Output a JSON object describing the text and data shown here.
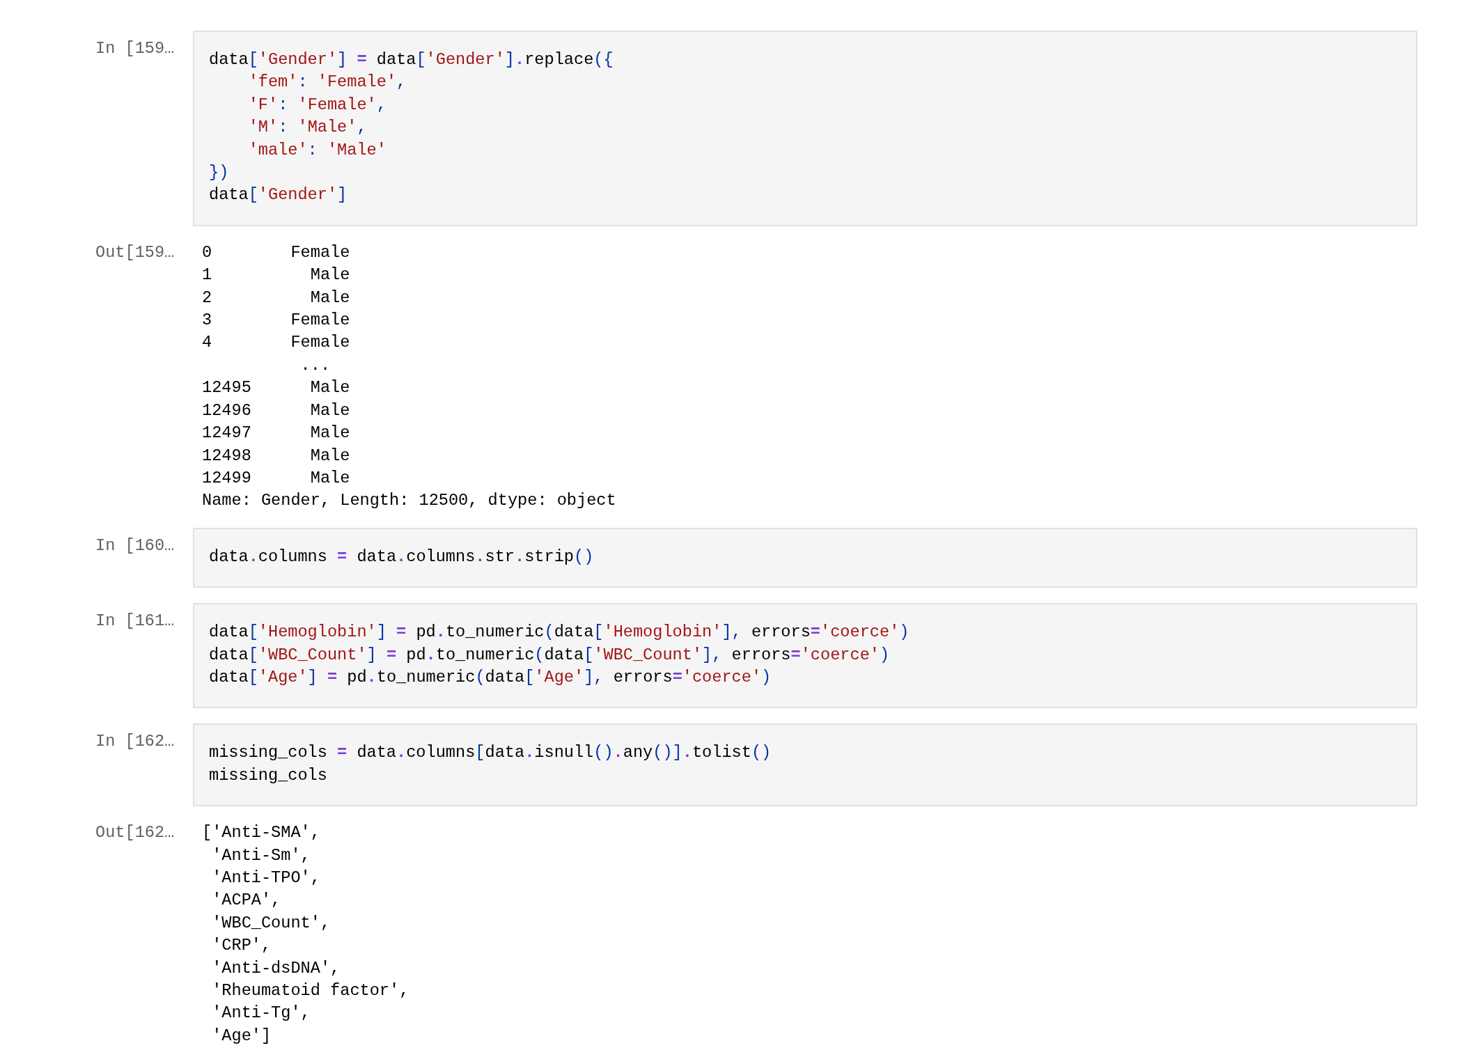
{
  "cells": [
    {
      "kind": "input",
      "prompt": "In [159…",
      "lines": [
        "data['Gender'] = data['Gender'].replace({",
        "    'fem': 'Female',",
        "    'F': 'Female',",
        "    'M': 'Male',",
        "    'male': 'Male'",
        "})",
        "data['Gender']"
      ]
    },
    {
      "kind": "output",
      "prompt": "Out[159…",
      "lines": [
        "0        Female",
        "1          Male",
        "2          Male",
        "3        Female",
        "4        Female",
        "          ...",
        "12495      Male",
        "12496      Male",
        "12497      Male",
        "12498      Male",
        "12499      Male",
        "Name: Gender, Length: 12500, dtype: object"
      ]
    },
    {
      "kind": "input",
      "prompt": "In [160…",
      "lines": [
        "data.columns = data.columns.str.strip()"
      ]
    },
    {
      "kind": "input",
      "prompt": "In [161…",
      "lines": [
        "data['Hemoglobin'] = pd.to_numeric(data['Hemoglobin'], errors='coerce')",
        "data['WBC_Count'] = pd.to_numeric(data['WBC_Count'], errors='coerce')",
        "data['Age'] = pd.to_numeric(data['Age'], errors='coerce')"
      ]
    },
    {
      "kind": "input",
      "prompt": "In [162…",
      "lines": [
        "missing_cols = data.columns[data.isnull().any()].tolist()",
        "missing_cols"
      ]
    },
    {
      "kind": "output",
      "prompt": "Out[162…",
      "lines": [
        "['Anti-SMA',",
        " 'Anti-Sm',",
        " 'Anti-TPO',",
        " 'ACPA',",
        " 'WBC_Count',",
        " 'CRP',",
        " 'Anti-dsDNA',",
        " 'Rheumatoid factor',",
        " 'Anti-Tg',",
        " 'Age']"
      ]
    }
  ]
}
